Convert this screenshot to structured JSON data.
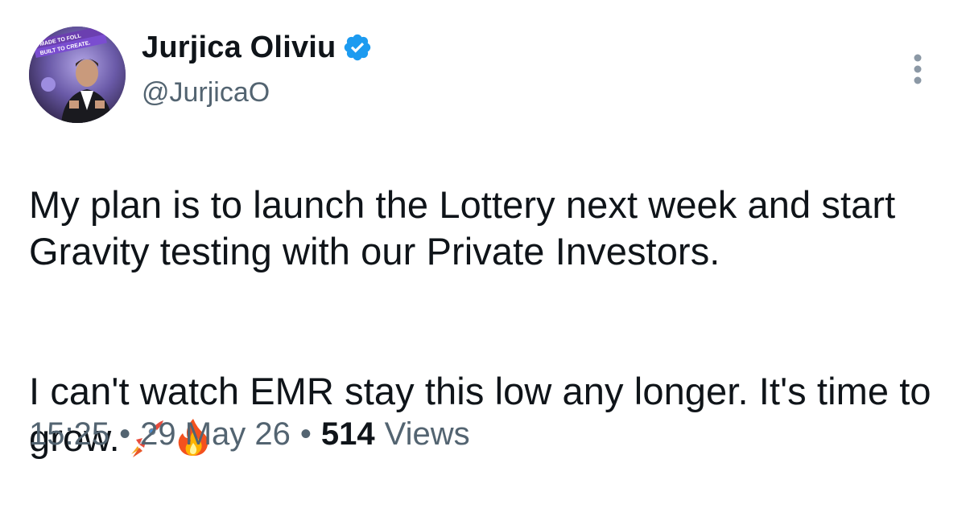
{
  "author": {
    "display_name": "Jurjica Oliviu",
    "handle": "@JurjicaO",
    "avatar_banner_top": "MADE TO FOLL",
    "avatar_banner_bottom": "BUILT TO CREATE."
  },
  "icons": {
    "verified": "verified-badge-icon",
    "more": "more-vertical-icon",
    "emoji_1": "rocket-emoji",
    "emoji_2": "fire-emoji"
  },
  "tweet": {
    "line_1": "My plan is to launch the Lottery next week and start Gravity testing with our Private Investors.",
    "line_2": "I can't watch EMR stay this low any longer. It's time to grow."
  },
  "meta": {
    "time": "15:25",
    "separator": "•",
    "date": "29 May 26",
    "views_count": "514",
    "views_label": "Views"
  },
  "colors": {
    "text_primary": "#0f1419",
    "text_secondary": "#536471",
    "verified_blue": "#1d9bf0"
  }
}
